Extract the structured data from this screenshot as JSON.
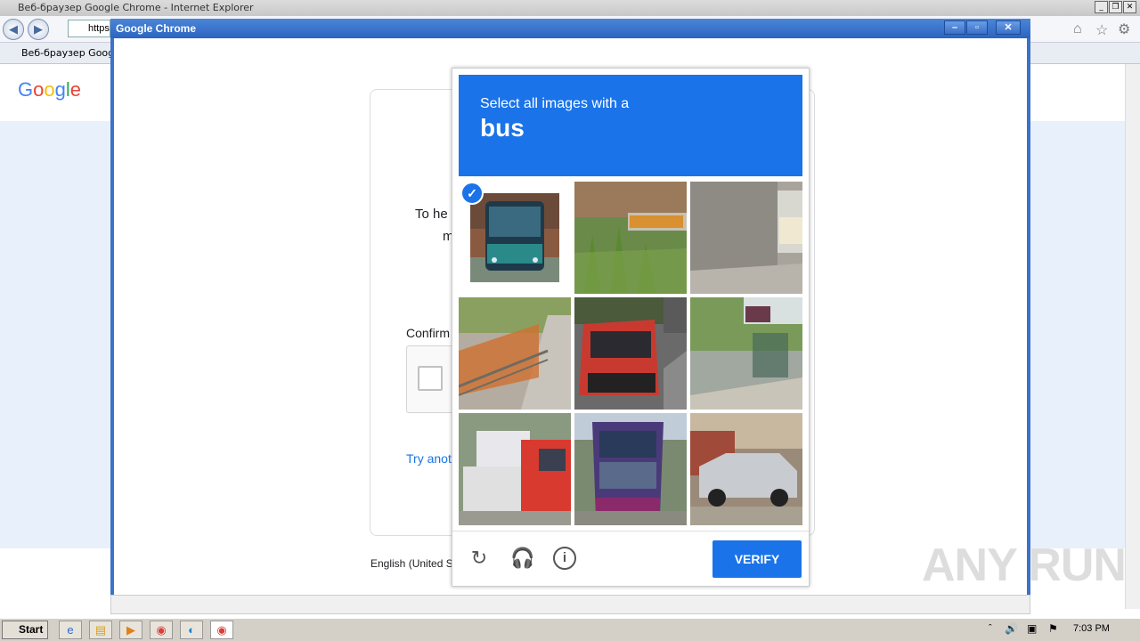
{
  "ie": {
    "title": "Веб-браузер Google Chrome - Internet Explorer",
    "address": "https",
    "tab_label": "Веб-браузер Google",
    "page_logo": "Google Ch"
  },
  "chrome_window": {
    "title": "Google Chrome"
  },
  "card": {
    "text_line1": "To he",
    "text_line2": "m",
    "confirm_label": "Confirm",
    "try_another": "Try anot",
    "language": "English (United S"
  },
  "captcha": {
    "instruction": "Select all images with a",
    "target": "bus",
    "verify_label": "VERIFY",
    "tiles": [
      {
        "id": "tile-1",
        "subject": "bus front",
        "selected": true
      },
      {
        "id": "tile-2",
        "subject": "plants and tanker truck",
        "selected": false
      },
      {
        "id": "tile-3",
        "subject": "concrete wall",
        "selected": false
      },
      {
        "id": "tile-4",
        "subject": "road with fence",
        "selected": false
      },
      {
        "id": "tile-5",
        "subject": "red van",
        "selected": false
      },
      {
        "id": "tile-6",
        "subject": "street with bus stop",
        "selected": false
      },
      {
        "id": "tile-7",
        "subject": "trucks",
        "selected": false
      },
      {
        "id": "tile-8",
        "subject": "purple bus",
        "selected": false
      },
      {
        "id": "tile-9",
        "subject": "silver car",
        "selected": false
      }
    ]
  },
  "watermark": "ANY RUN",
  "taskbar": {
    "start_label": "Start",
    "clock": "7:03 PM"
  },
  "colors": {
    "captcha_blue": "#1a73e8",
    "chrome_titlebar": "#2b64c0"
  }
}
